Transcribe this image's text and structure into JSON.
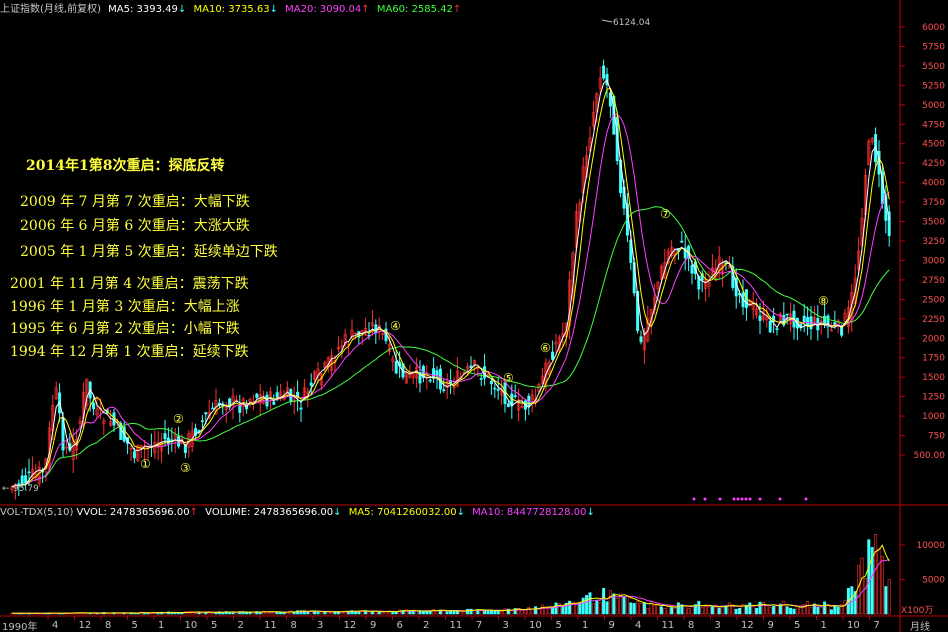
{
  "header": {
    "index_name": "上证指数(月线,前复权)",
    "ma5_label": "MA5: 3393.49",
    "ma10_label": "MA10: 3735.63",
    "ma20_label": "MA20: 3090.04",
    "ma60_label": "MA60: 2585.42",
    "down_arrow": "↓",
    "up_arrow": "↑"
  },
  "colors": {
    "ma5": "#ffffff",
    "ma10": "#ffff00",
    "ma20": "#ff40ff",
    "ma60": "#40ff40",
    "candle_up": "#ff3030",
    "candle_down": "#40ffff",
    "axis": "#ff3030",
    "annotation": "#ffff40"
  },
  "price_chart": {
    "y_ticks": [
      "6000",
      "5750",
      "5500",
      "5250",
      "5000",
      "4750",
      "4500",
      "4250",
      "4000",
      "3750",
      "3500",
      "3250",
      "3000",
      "2750",
      "2500",
      "2250",
      "2000",
      "1750",
      "1500",
      "1250",
      "1000",
      "750",
      "500.00"
    ],
    "high_label": "6124.04",
    "low_label": "95.79",
    "cycle_markers": [
      "①",
      "②",
      "③",
      "④",
      "⑤",
      "⑥",
      "⑦",
      "⑧"
    ]
  },
  "annotations": {
    "title": "2014年1第8次重启：探底反转",
    "line7": "2009 年 7 月第 7 次重启：大幅下跌",
    "line6": "2006 年 6 月第 6 次重启：大涨大跌",
    "line5": "2005 年 1 月第 5 次重启：延续单边下跌",
    "line4": "2001 年 11 月第 4 次重启：震荡下跌",
    "line3": "1996 年 1 月第 3 次重启：大幅上涨",
    "line2": "1995 年 6 月第 2 次重启：小幅下跌",
    "line1": "1994 年 12 月第 1 次重启：延续下跌"
  },
  "volume_header": {
    "indicator": "VOL-TDX(5,10)",
    "vvol": "VVOL: 2478365696.00",
    "volume": "VOLUME: 2478365696.00",
    "ma5": "MA5: 7041260032.00",
    "ma10": "MA10: 8447728128.00"
  },
  "volume_chart": {
    "y_ticks": [
      "10000",
      "5000"
    ],
    "unit": "X100万"
  },
  "x_axis": {
    "first_label": "1990年",
    "period": "月线",
    "labels": [
      "4",
      "12",
      "8",
      "5",
      "1",
      "10",
      "5",
      "2",
      "11",
      "8",
      "3",
      "12",
      "9",
      "6",
      "2",
      "11",
      "7",
      "3",
      "10",
      "5",
      "1",
      "9",
      "4",
      "11",
      "8",
      "3",
      "12",
      "9",
      "5",
      "1",
      "10",
      "7"
    ]
  }
}
